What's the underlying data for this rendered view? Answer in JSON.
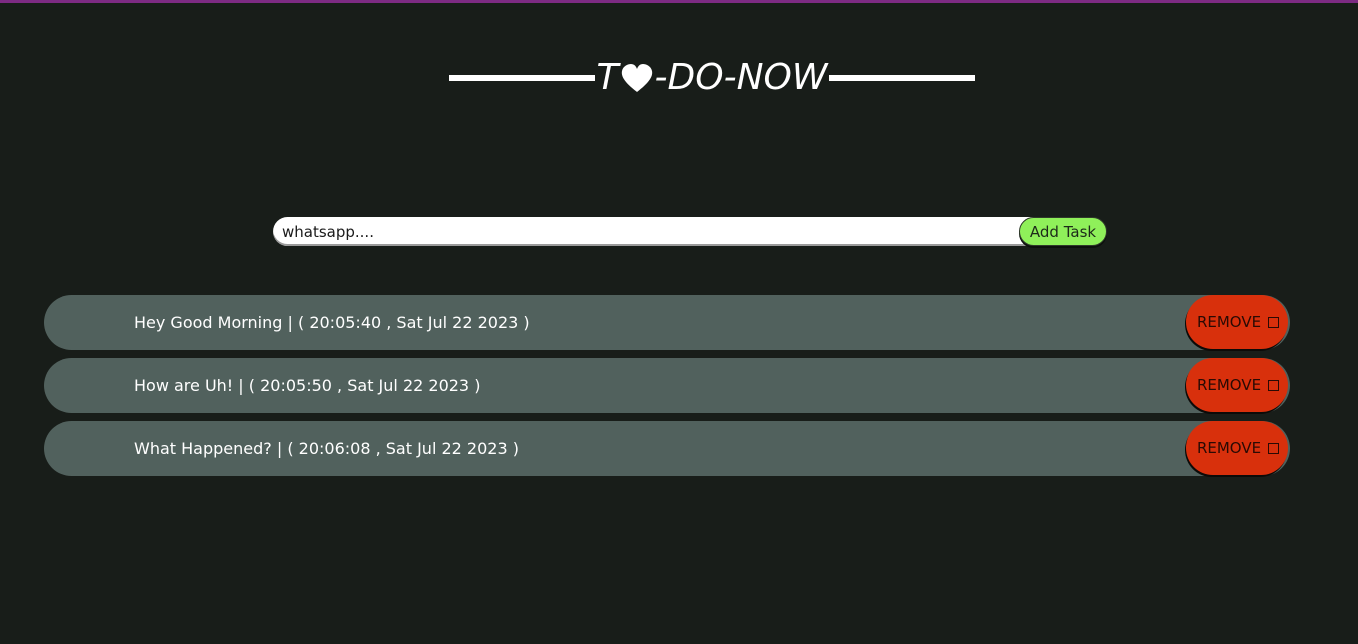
{
  "header": {
    "title_prefix": "T",
    "heart_icon": "heart-icon",
    "title_suffix": "-DO-NOW"
  },
  "add_task": {
    "input_value": "whatsapp....",
    "button_label": "Add Task"
  },
  "tasks": [
    {
      "text": "Hey Good Morning | ( 20:05:40 , Sat Jul 22 2023 )",
      "remove_label": "REMOVE"
    },
    {
      "text": "How are Uh! | ( 20:05:50 , Sat Jul 22 2023 )",
      "remove_label": "REMOVE"
    },
    {
      "text": "What Happened? | ( 20:06:08 , Sat Jul 22 2023 )",
      "remove_label": "REMOVE"
    }
  ],
  "colors": {
    "background": "#181d19",
    "top_accent": "#7d2b83",
    "task_row": "#51615d",
    "remove_button": "#d8300c",
    "add_button": "#8ff05a"
  }
}
